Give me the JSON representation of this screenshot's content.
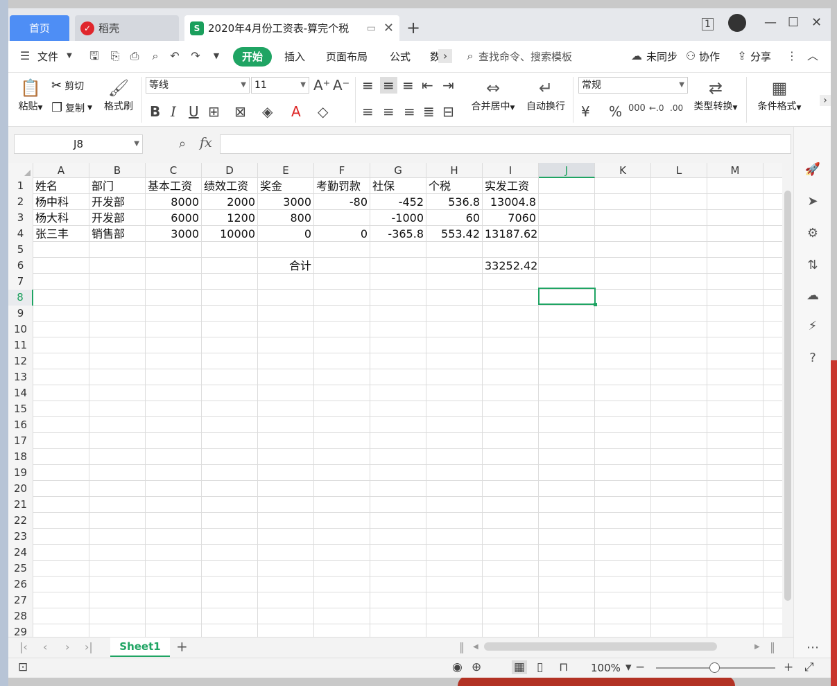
{
  "tabs": {
    "home": "首页",
    "daoke": "稻壳",
    "document": "2020年4月份工资表-算完个税"
  },
  "menu": {
    "file": "文件",
    "items": [
      "开始",
      "插入",
      "页面布局",
      "公式",
      "数"
    ],
    "search_placeholder": "查找命令、搜索模板",
    "sync": "未同步",
    "collab": "协作",
    "share": "分享"
  },
  "ribbon": {
    "paste": "粘贴",
    "cut": "剪切",
    "copy": "复制",
    "format_painter": "格式刷",
    "font_name": "等线",
    "font_size": "11",
    "merge_center": "合并居中",
    "wrap_text": "自动换行",
    "number_format": "常规",
    "type_convert": "类型转换",
    "cond_format": "条件格式"
  },
  "formula": {
    "namebox": "J8",
    "fx": "fx",
    "value": ""
  },
  "columns": [
    "A",
    "B",
    "C",
    "D",
    "E",
    "F",
    "G",
    "H",
    "I",
    "J",
    "K",
    "L",
    "M"
  ],
  "rows": [
    {
      "num": "1",
      "cells": [
        "姓名",
        "部门",
        "基本工资",
        "绩效工资",
        "奖金",
        "考勤罚款",
        "社保",
        "个税",
        "实发工资"
      ]
    },
    {
      "num": "2",
      "cells": [
        "杨中科",
        "开发部",
        "8000",
        "2000",
        "3000",
        "-80",
        "-452",
        "536.8",
        "13004.8"
      ]
    },
    {
      "num": "3",
      "cells": [
        "杨大科",
        "开发部",
        "6000",
        "1200",
        "800",
        "",
        "-1000",
        "60",
        "7060"
      ]
    },
    {
      "num": "4",
      "cells": [
        "张三丰",
        "销售部",
        "3000",
        "10000",
        "0",
        "0",
        "-365.8",
        "553.42",
        "13187.62"
      ]
    },
    {
      "num": "5",
      "cells": [
        "",
        "",
        "",
        "",
        "",
        "",
        "",
        "",
        ""
      ]
    },
    {
      "num": "6",
      "cells": [
        "",
        "",
        "",
        "",
        "合计",
        "",
        "",
        "",
        "33252.42"
      ]
    },
    {
      "num": "7",
      "cells": []
    },
    {
      "num": "8",
      "cells": []
    },
    {
      "num": "9",
      "cells": []
    },
    {
      "num": "10",
      "cells": []
    },
    {
      "num": "11",
      "cells": []
    },
    {
      "num": "12",
      "cells": []
    },
    {
      "num": "13",
      "cells": []
    },
    {
      "num": "14",
      "cells": []
    },
    {
      "num": "15",
      "cells": []
    },
    {
      "num": "16",
      "cells": []
    },
    {
      "num": "17",
      "cells": []
    },
    {
      "num": "18",
      "cells": []
    },
    {
      "num": "19",
      "cells": []
    },
    {
      "num": "20",
      "cells": []
    },
    {
      "num": "21",
      "cells": []
    },
    {
      "num": "22",
      "cells": []
    },
    {
      "num": "23",
      "cells": []
    },
    {
      "num": "24",
      "cells": []
    },
    {
      "num": "25",
      "cells": []
    },
    {
      "num": "26",
      "cells": []
    },
    {
      "num": "27",
      "cells": []
    },
    {
      "num": "28",
      "cells": []
    },
    {
      "num": "29",
      "cells": []
    }
  ],
  "sheet": {
    "name": "Sheet1"
  },
  "status": {
    "zoom": "100%"
  },
  "colors": {
    "accent": "#1fa463",
    "home_tab": "#4e8ef5"
  }
}
